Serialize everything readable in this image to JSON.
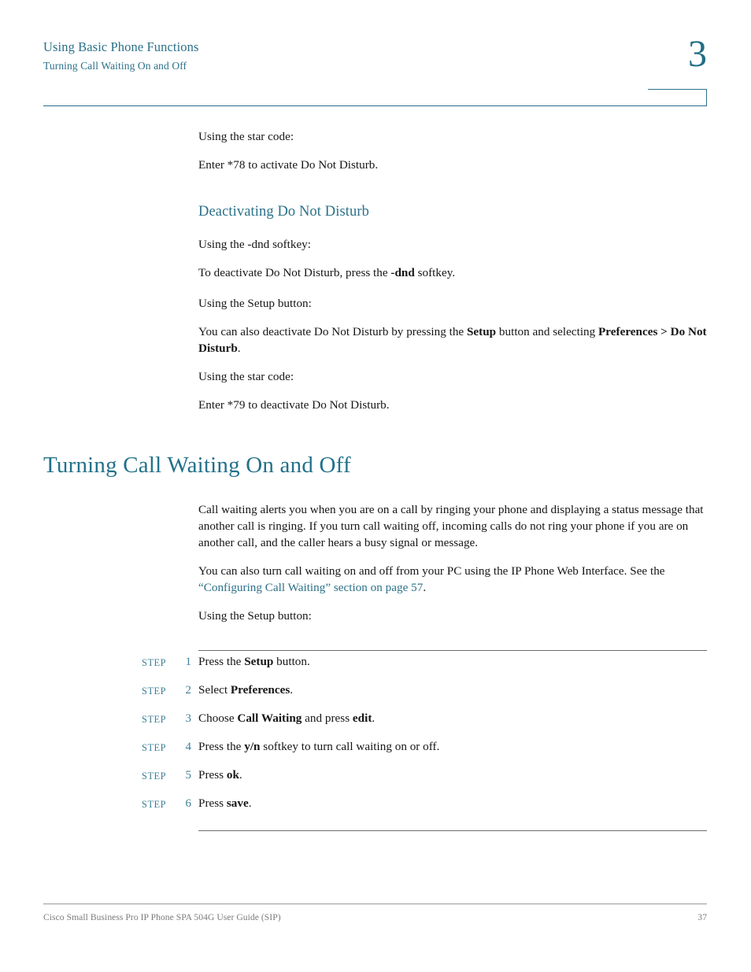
{
  "colors": {
    "accent_teal": "#23718a",
    "header_teal": "#2c7189",
    "step_teal": "#3e7f96",
    "body_text": "#161616",
    "footer_gray": "#7b7b7b",
    "rule_gray": "#6d6d6d"
  },
  "header": {
    "chapter_title": "Using Basic Phone Functions",
    "section_title": "Turning Call Waiting On and Off",
    "chapter_number": "3"
  },
  "body": {
    "intro_dnd": {
      "star_code_label": "Using the star code:",
      "star_code_text": "Enter *78 to activate Do Not Disturb."
    },
    "deactivating": {
      "heading": "Deactivating Do Not Disturb",
      "softkey_label": "Using the -dnd softkey:",
      "softkey_text_pre": "To deactivate Do Not Disturb, press the ",
      "softkey_text_bold": "-dnd",
      "softkey_text_post": " softkey.",
      "setup_label": "Using the Setup button:",
      "setup_text_pre": "You can also deactivate Do Not Disturb by pressing the ",
      "setup_text_bold1": "Setup",
      "setup_text_mid": " button and selecting ",
      "setup_text_bold2": "Preferences",
      "setup_text_gt": " > ",
      "setup_text_bold3": "Do Not Disturb",
      "setup_text_post": ".",
      "star_code_label": "Using the star code:",
      "star_code_text": "Enter *79 to deactivate Do Not Disturb."
    }
  },
  "section": {
    "title": "Turning Call Waiting On and Off",
    "paragraph1": "Call waiting alerts you when you are on a call by ringing your phone and displaying a status message that another call is ringing. If you turn call waiting off, incoming calls do not ring your phone if you are on another call, and the caller hears a busy signal or message.",
    "paragraph2_pre": "You can also turn call waiting on and off from your PC using the IP Phone Web Interface. See the ",
    "paragraph2_link": "“Configuring Call Waiting” section on page 57",
    "paragraph2_post": ".",
    "setup_label": "Using the Setup button:"
  },
  "steps": {
    "label": "STEP",
    "items": [
      {
        "number": "1",
        "pre": "Press the ",
        "bold": "Setup",
        "post": " button."
      },
      {
        "number": "2",
        "pre": "Select ",
        "bold": "Preferences",
        "post": "."
      },
      {
        "number": "3",
        "pre": "Choose ",
        "bold": "Call Waiting",
        "mid": " and press ",
        "bold2": "edit",
        "post": "."
      },
      {
        "number": "4",
        "pre": "Press the ",
        "bold": "y/n",
        "post": " softkey to turn call waiting on or off."
      },
      {
        "number": "5",
        "pre": "Press ",
        "bold": "ok",
        "post": "."
      },
      {
        "number": "6",
        "pre": "Press ",
        "bold": "save",
        "post": "."
      }
    ]
  },
  "footer": {
    "text": "Cisco Small Business Pro IP Phone SPA 504G User Guide (SIP)",
    "page_number": "37"
  }
}
